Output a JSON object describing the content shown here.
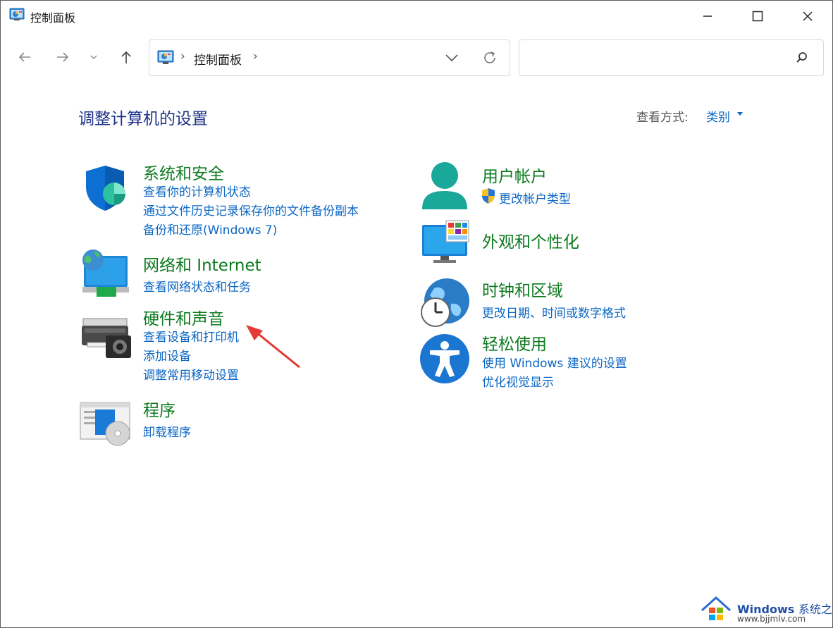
{
  "window": {
    "title": "控制面板"
  },
  "address": {
    "path_label": "控制面板"
  },
  "search": {
    "placeholder": ""
  },
  "page": {
    "title": "调整计算机的设置",
    "view_by_label": "查看方式:",
    "view_by_value": "类别"
  },
  "categories": {
    "system": {
      "title": "系统和安全",
      "links": [
        "查看你的计算机状态",
        "通过文件历史记录保存你的文件备份副本",
        "备份和还原(Windows 7)"
      ]
    },
    "network": {
      "title": "网络和 Internet",
      "links": [
        "查看网络状态和任务"
      ]
    },
    "hardware": {
      "title": "硬件和声音",
      "links": [
        "查看设备和打印机",
        "添加设备",
        "调整常用移动设置"
      ]
    },
    "programs": {
      "title": "程序",
      "links": [
        "卸载程序"
      ]
    },
    "user": {
      "title": "用户帐户",
      "links": [
        "更改帐户类型"
      ]
    },
    "appearance": {
      "title": "外观和个性化",
      "links": []
    },
    "clock": {
      "title": "时钟和区域",
      "links": [
        "更改日期、时间或数字格式"
      ]
    },
    "ease": {
      "title": "轻松使用",
      "links": [
        "使用 Windows 建议的设置",
        "优化视觉显示"
      ]
    }
  },
  "watermark": {
    "brand": "Windows",
    "brand_cn": "系统之家",
    "url": "www.bjjmlv.com"
  },
  "colors": {
    "category_title": "#0c7a1e",
    "link": "#0b66c3",
    "page_title": "#1e3287",
    "annotation_arrow": "#e53935"
  }
}
